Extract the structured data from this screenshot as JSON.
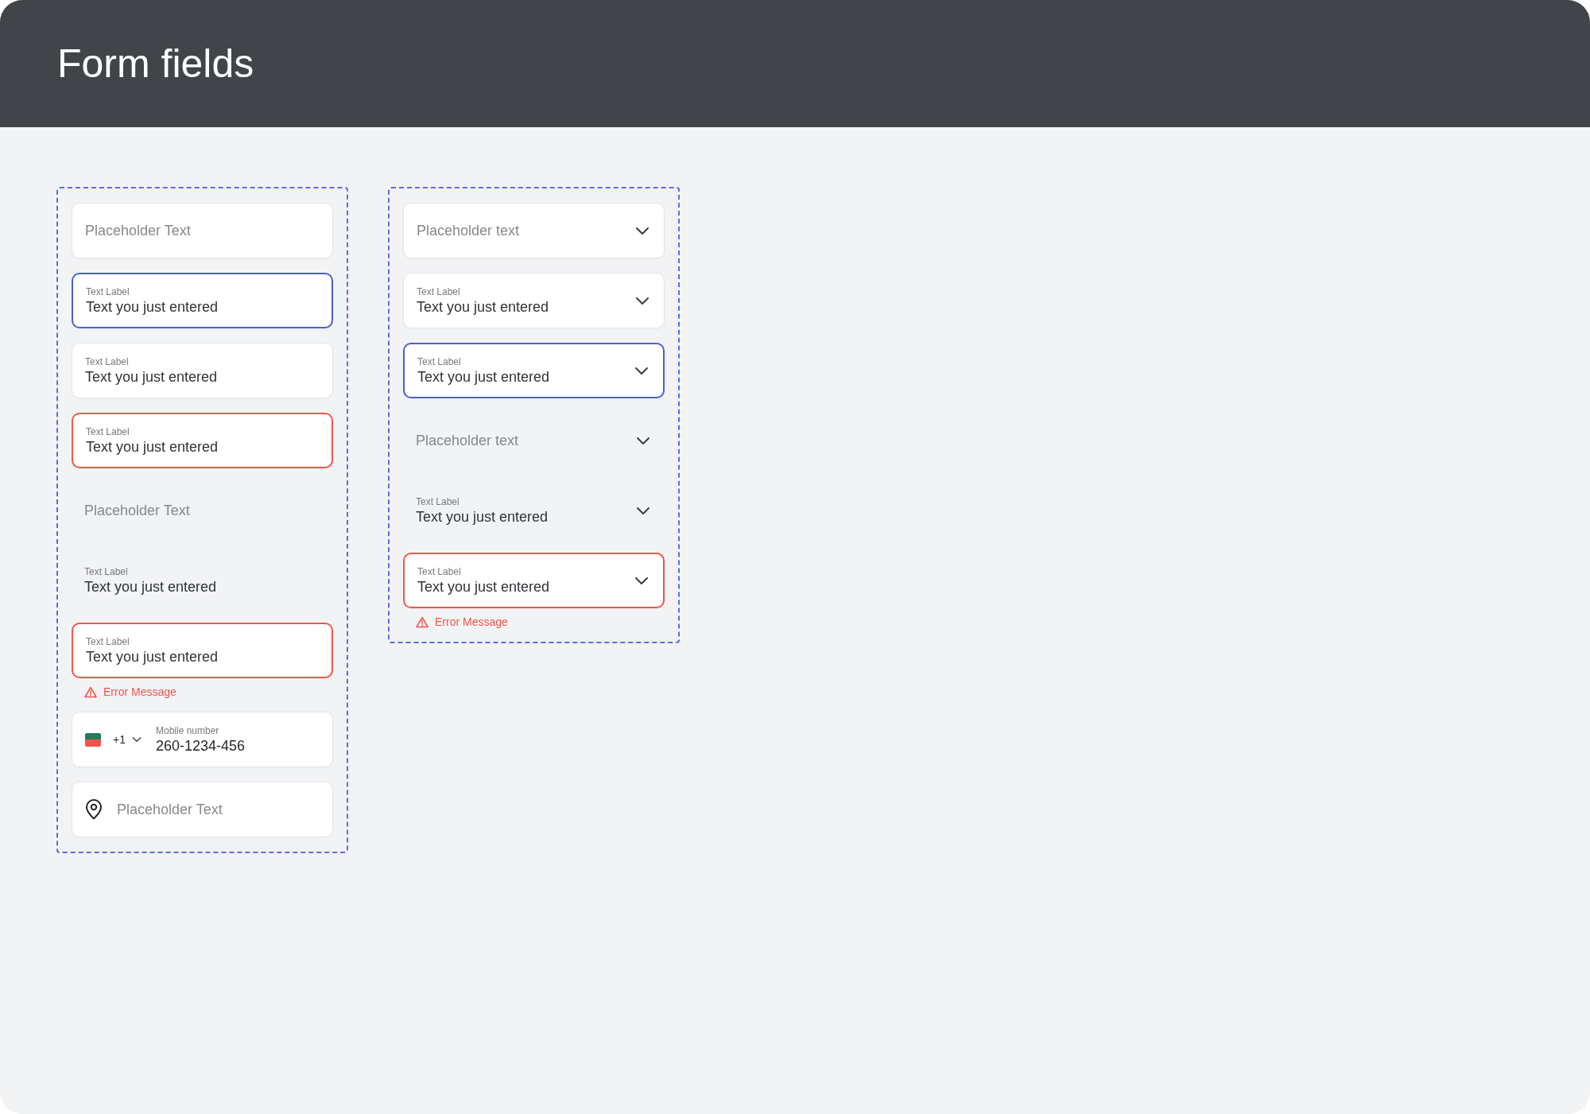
{
  "header": {
    "title": "Form fields"
  },
  "text_fields": [
    {
      "kind": "text",
      "focused": false,
      "error": false,
      "filled_style": true,
      "placeholder": "Placeholder Text"
    },
    {
      "kind": "text",
      "focused": true,
      "error": false,
      "filled_style": true,
      "label": "Text Label",
      "value": "Text you just entered"
    },
    {
      "kind": "text",
      "focused": false,
      "error": false,
      "filled_style": true,
      "label": "Text Label",
      "value": "Text you just entered"
    },
    {
      "kind": "text",
      "focused": false,
      "error": true,
      "filled_style": true,
      "label": "Text Label",
      "value": "Text you just entered"
    },
    {
      "kind": "text",
      "focused": false,
      "error": false,
      "filled_style": false,
      "placeholder": "Placeholder Text"
    },
    {
      "kind": "text",
      "focused": false,
      "error": false,
      "filled_style": false,
      "label": "Text Label",
      "value": "Text you just entered"
    },
    {
      "kind": "text",
      "focused": false,
      "error": true,
      "filled_style": true,
      "label": "Text Label",
      "value": "Text you just entered",
      "error_message": "Error Message"
    },
    {
      "kind": "phone",
      "focused": false,
      "error": false,
      "filled_style": true,
      "country_code": "+1",
      "label": "Mobile number",
      "value": "260-1234-456"
    },
    {
      "kind": "location",
      "focused": false,
      "error": false,
      "filled_style": true,
      "placeholder": "Placeholder Text"
    }
  ],
  "select_fields": [
    {
      "kind": "select",
      "focused": false,
      "error": false,
      "filled_style": true,
      "placeholder": "Placeholder text"
    },
    {
      "kind": "select",
      "focused": false,
      "error": false,
      "filled_style": true,
      "label": "Text Label",
      "value": "Text you just entered"
    },
    {
      "kind": "select",
      "focused": true,
      "error": false,
      "filled_style": true,
      "label": "Text Label",
      "value": "Text you just entered"
    },
    {
      "kind": "select",
      "focused": false,
      "error": false,
      "filled_style": false,
      "placeholder": "Placeholder text"
    },
    {
      "kind": "select",
      "focused": false,
      "error": false,
      "filled_style": false,
      "label": "Text Label",
      "value": "Text you just entered"
    },
    {
      "kind": "select",
      "focused": false,
      "error": true,
      "filled_style": true,
      "label": "Text Label",
      "value": "Text you just entered",
      "error_message": "Error Message"
    }
  ]
}
